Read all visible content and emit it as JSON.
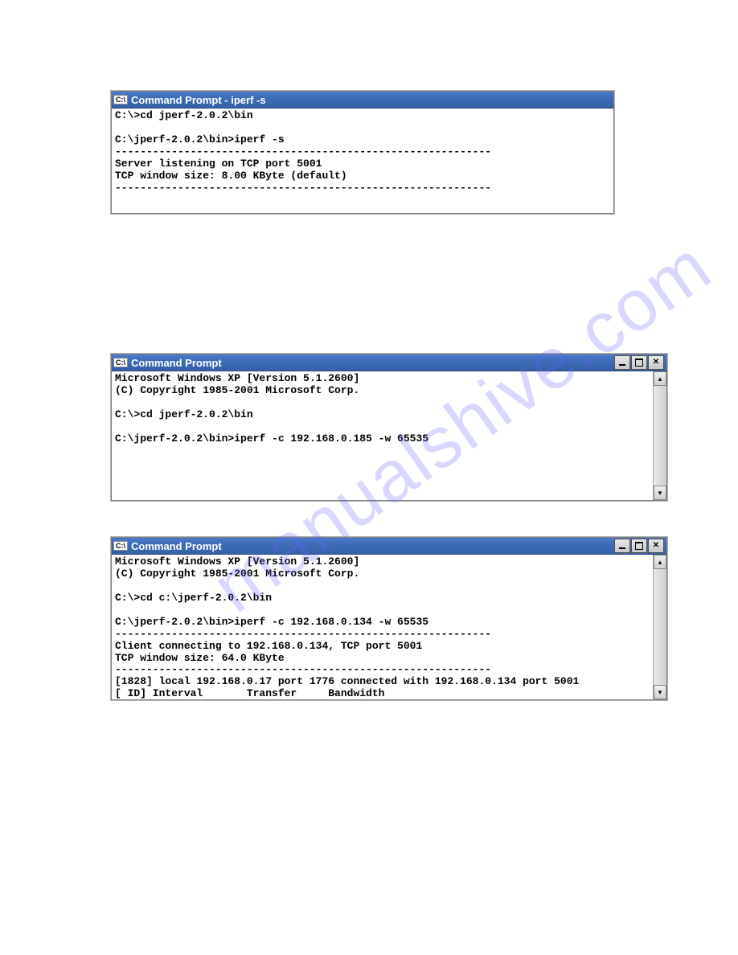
{
  "watermark": "manualshive.com",
  "windows": {
    "w1": {
      "icon_label": "C:\\",
      "title": "Command Prompt - iperf -s",
      "has_controls": false,
      "body": "C:\\>cd jperf-2.0.2\\bin\n\nC:\\jperf-2.0.2\\bin>iperf -s\n------------------------------------------------------------\nServer listening on TCP port 5001\nTCP window size: 8.00 KByte (default)\n------------------------------------------------------------\n"
    },
    "w2": {
      "icon_label": "C:\\",
      "title": "Command Prompt",
      "has_controls": true,
      "has_scrollbar": true,
      "body": "Microsoft Windows XP [Version 5.1.2600]\n(C) Copyright 1985-2001 Microsoft Corp.\n\nC:\\>cd jperf-2.0.2\\bin\n\nC:\\jperf-2.0.2\\bin>iperf -c 192.168.0.185 -w 65535\n"
    },
    "w3": {
      "icon_label": "C:\\",
      "title": "Command Prompt",
      "has_controls": true,
      "has_scrollbar": true,
      "body": "Microsoft Windows XP [Version 5.1.2600]\n(C) Copyright 1985-2001 Microsoft Corp.\n\nC:\\>cd c:\\jperf-2.0.2\\bin\n\nC:\\jperf-2.0.2\\bin>iperf -c 192.168.0.134 -w 65535\n------------------------------------------------------------\nClient connecting to 192.168.0.134, TCP port 5001\nTCP window size: 64.0 KByte\n------------------------------------------------------------\n[1828] local 192.168.0.17 port 1776 connected with 192.168.0.134 port 5001\n[ ID] Interval       Transfer     Bandwidth"
    }
  }
}
